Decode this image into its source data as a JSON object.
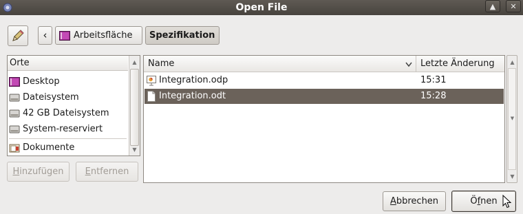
{
  "window": {
    "title": "Open File"
  },
  "path_bar": {
    "back_arrow": "‹",
    "crumbs": [
      {
        "label": "Arbeitsfläche"
      },
      {
        "label": "Spezifikation"
      }
    ]
  },
  "places": {
    "header": "Orte",
    "items": [
      {
        "label": "Desktop",
        "icon": "desktop-icon"
      },
      {
        "label": "Dateisystem",
        "icon": "drive-icon"
      },
      {
        "label": "42 GB Dateisystem",
        "icon": "drive-icon"
      },
      {
        "label": "System-reserviert",
        "icon": "drive-icon"
      },
      {
        "label": "Dokumente",
        "icon": "folder-icon"
      }
    ],
    "add_label_u": "H",
    "add_label_rest": "inzufügen",
    "remove_label_u": "E",
    "remove_label_rest": "ntfernen"
  },
  "files": {
    "columns": {
      "name": "Name",
      "modified": "Letzte Änderung"
    },
    "rows": [
      {
        "name": "Integration.odp",
        "time": "15:31",
        "selected": false
      },
      {
        "name": "Integration.odt",
        "time": "15:28",
        "selected": true
      }
    ]
  },
  "actions": {
    "cancel_u": "A",
    "cancel_rest": "bbrechen",
    "open_u": "f",
    "open_pre": "Ö",
    "open_rest": "nen"
  },
  "colors": {
    "titlebar": "#47433e",
    "selection": "#6b625a",
    "window_bg": "#edeceb"
  }
}
